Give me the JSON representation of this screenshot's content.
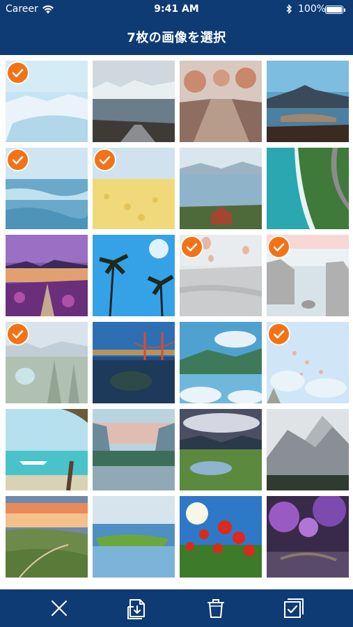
{
  "status": {
    "carrier": "Career",
    "time": "9:41 AM",
    "battery": "100%"
  },
  "header": {
    "title": "7枚の画像を選択"
  },
  "colors": {
    "header_bg": "#0e3b74",
    "check": "#f47216"
  },
  "toolbar": {
    "buttons": [
      {
        "icon": "close-icon"
      },
      {
        "icon": "save-to-device-icon"
      },
      {
        "icon": "trash-icon"
      },
      {
        "icon": "select-all-icon"
      }
    ]
  },
  "photos": [
    {
      "subject": "snowy mountain lake",
      "selected": true
    },
    {
      "subject": "alpine road with lake",
      "selected": false
    },
    {
      "subject": "tree-lined boardwalk path",
      "selected": false
    },
    {
      "subject": "mountain at sunset over lake",
      "selected": false
    },
    {
      "subject": "ocean waves",
      "selected": true
    },
    {
      "subject": "yellow flower field",
      "selected": true
    },
    {
      "subject": "lake with red-roof village",
      "selected": false
    },
    {
      "subject": "aerial coastal road",
      "selected": false
    },
    {
      "subject": "purple lakeside flowers",
      "selected": false
    },
    {
      "subject": "palm trees under blue sky",
      "selected": false
    },
    {
      "subject": "hot air balloons over rocks",
      "selected": true
    },
    {
      "subject": "sea rocks at dawn",
      "selected": true
    },
    {
      "subject": "forest lake with mountains",
      "selected": true
    },
    {
      "subject": "golden gate bridge at dusk",
      "selected": false
    },
    {
      "subject": "green mountains above clouds",
      "selected": false
    },
    {
      "subject": "balloons in blue sky",
      "selected": true
    },
    {
      "subject": "tropical beach with boat",
      "selected": false
    },
    {
      "subject": "valley lake at sunset",
      "selected": false
    },
    {
      "subject": "mountain lake with clouds",
      "selected": false
    },
    {
      "subject": "rocky mountain peaks",
      "selected": false
    },
    {
      "subject": "rolling hills at sunset",
      "selected": false
    },
    {
      "subject": "grassy island on lake",
      "selected": false
    },
    {
      "subject": "red poppies with sun",
      "selected": false
    },
    {
      "subject": "purple blossom garden",
      "selected": false
    }
  ]
}
